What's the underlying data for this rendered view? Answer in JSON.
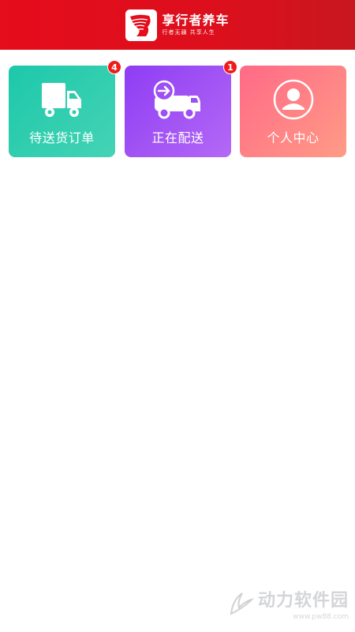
{
  "header": {
    "brand_name": "享行者养车",
    "brand_slogan": "行者无疆 共享人生",
    "background_color": "#e50c1b",
    "logo_icon": "stylized-profile-logo"
  },
  "cards": [
    {
      "label": "待送货订单",
      "badge": "4",
      "icon": "delivery-truck-icon",
      "color": "#1dc8aa"
    },
    {
      "label": "正在配送",
      "badge": "1",
      "icon": "truck-in-transit-icon",
      "color": "#8e3df4"
    },
    {
      "label": "个人中心",
      "icon": "user-profile-icon",
      "color": "#ff6a86"
    }
  ],
  "watermark": {
    "title": "动力软件园",
    "url": "www.pw88.com"
  }
}
